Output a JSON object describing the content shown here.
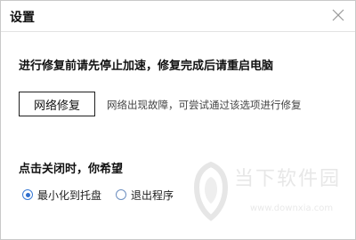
{
  "dialog": {
    "title": "设置",
    "close_icon": "close-icon"
  },
  "repair_section": {
    "heading": "进行修复前请先停止加速，修复完成后请重启电脑",
    "button_label": "网络修复",
    "hint": "网络出现故障，可尝试通过该选项进行修复"
  },
  "close_section": {
    "heading": "点击关闭时，你希望",
    "options": [
      {
        "label": "最小化到托盘",
        "selected": true
      },
      {
        "label": "退出程序",
        "selected": false
      }
    ]
  },
  "watermark": {
    "text": "当下软件园",
    "url": "www.downxia.com"
  },
  "colors": {
    "accent": "#2f6fce",
    "border": "#c9c9c9"
  }
}
